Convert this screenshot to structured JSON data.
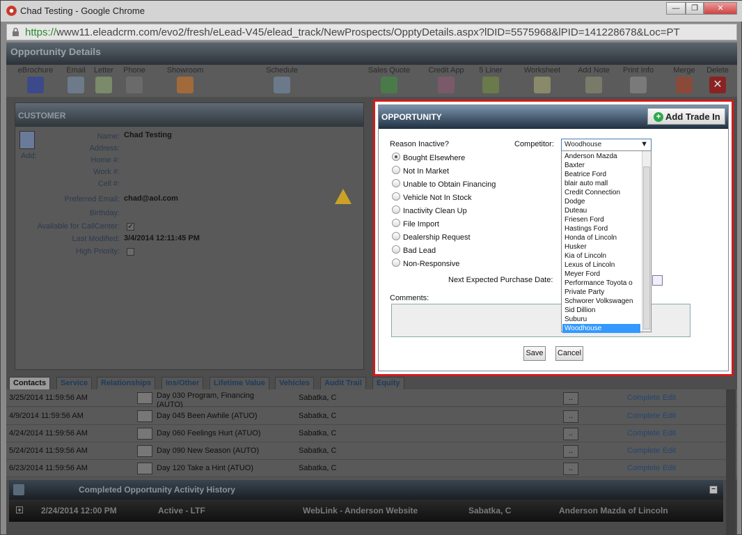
{
  "window": {
    "title": "Chad Testing - Google Chrome",
    "url_scheme": "https://",
    "url_rest": "www11.eleadcrm.com/evo2/fresh/eLead-V45/elead_track/NewProspects/OpptyDetails.aspx?lDID=5575968&lPID=141228678&Loc=PT"
  },
  "header": {
    "title": "Opportunity Details"
  },
  "toolbar": {
    "items": [
      "eBrochure",
      "Email",
      "Letter",
      "Phone",
      "Showroom",
      "Schedule",
      "Sales Quote",
      "Credit App",
      "5 Liner",
      "Worksheet",
      "Add Note",
      "Print Info",
      "Merge",
      "Delete"
    ]
  },
  "customer": {
    "title": "CUSTOMER",
    "add_label": "Add:",
    "labels": {
      "name": "Name:",
      "address": "Address:",
      "home": "Home #:",
      "work": "Work #:",
      "cell": "Cell #:",
      "email": "Preferred Email:",
      "birthday": "Birthday:",
      "callcenter": "Available for CallCenter:",
      "modified": "Last Modified:",
      "priority": "High Priority:"
    },
    "values": {
      "name": "Chad Testing",
      "email": "chad@aol.com",
      "modified": "3/4/2014 12:11:45 PM"
    },
    "callcenter_checked": true,
    "priority_checked": false
  },
  "opportunity": {
    "title": "OPPORTUNITY",
    "add_trade_label": "Add Trade In",
    "reason_label": "Reason Inactive?",
    "competitor_label": "Competitor:",
    "competitor_value": "Woodhouse",
    "reasons": [
      "Bought Elsewhere",
      "Not In Market",
      "Unable to Obtain Financing",
      "Vehicle Not In Stock",
      "Inactivity Clean Up",
      "File Import",
      "Dealership Request",
      "Bad Lead",
      "Non-Responsive"
    ],
    "selected_reason": "Bought Elsewhere",
    "competitors": [
      "Anderson Mazda",
      "Baxter",
      "Beatrice Ford",
      "blair auto mall",
      "Credit Connection",
      "Dodge",
      "Duteau",
      "Friesen Ford",
      "Hastings Ford",
      "Honda of Lincoln",
      "Husker",
      "Kia of Lincoln",
      "Lexus of Lincoln",
      "Meyer Ford",
      "Performance Toyota o",
      "Private Party",
      "Schworer Volkswagen",
      "Sid Dillion",
      "Suburu",
      "Woodhouse"
    ],
    "selected_competitor": "Woodhouse",
    "next_purchase_label": "Next Expected Purchase Date:",
    "comments_label": "Comments:",
    "save_label": "Save",
    "cancel_label": "Cancel"
  },
  "tabs": [
    "Contacts",
    "Service",
    "Relationships",
    "Ins/Other",
    "Lifetime Value",
    "Vehicles",
    "Audit Trail",
    "Equity"
  ],
  "activities": [
    {
      "date": "3/25/2014 11:59:56 AM",
      "desc": "Day 030 Program, Financing (AUTO)",
      "who": "Sabatka, C"
    },
    {
      "date": "4/9/2014 11:59:56 AM",
      "desc": "Day 045 Been Awhile (ATUO)",
      "who": "Sabatka, C"
    },
    {
      "date": "4/24/2014 11:59:56 AM",
      "desc": "Day 060 Feelings Hurt (ATUO)",
      "who": "Sabatka, C"
    },
    {
      "date": "5/24/2014 11:59:56 AM",
      "desc": "Day 090 New Season (AUTO)",
      "who": "Sabatka, C"
    },
    {
      "date": "6/23/2014 11:59:56 AM",
      "desc": "Day 120 Take a Hint (ATUO)",
      "who": "Sabatka, C"
    }
  ],
  "activity_actions": {
    "dots": "..",
    "complete": "Complete",
    "edit": "Edit"
  },
  "history": {
    "title": "Completed Opportunity Activity History",
    "row": {
      "date": "2/24/2014 12:00 PM",
      "status": "Active - LTF",
      "source": "WebLink - Anderson Website",
      "who": "Sabatka, C",
      "dealer": "Anderson Mazda of Lincoln"
    }
  }
}
